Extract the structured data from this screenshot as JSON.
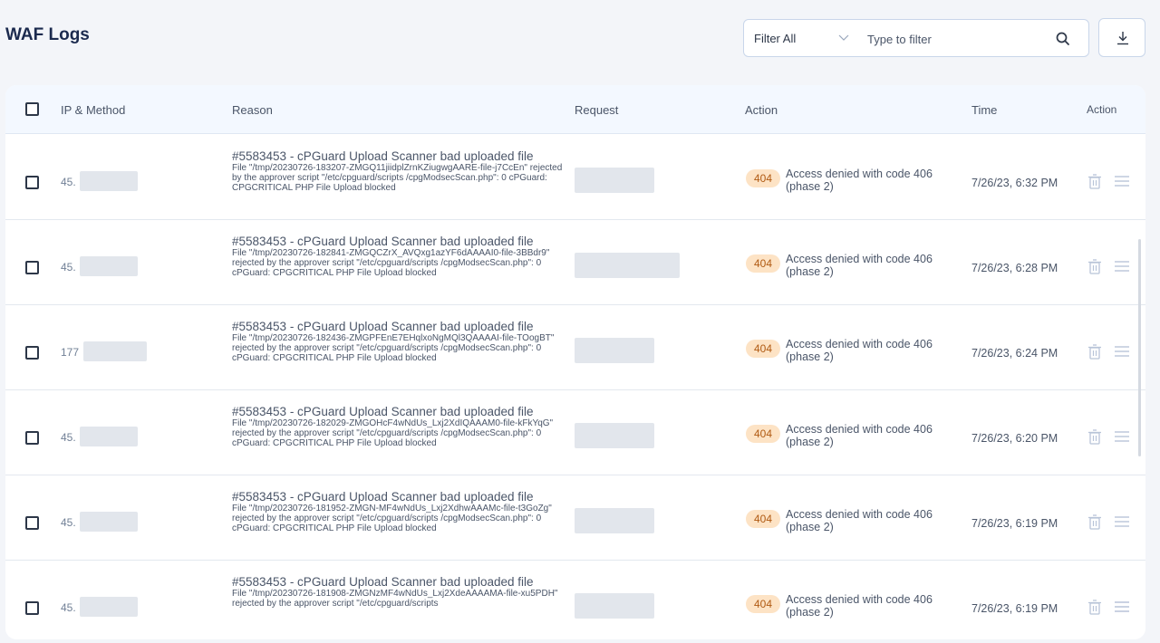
{
  "page": {
    "title": "WAF Logs"
  },
  "filter": {
    "select_label": "Filter All",
    "placeholder": "Type to filter"
  },
  "table": {
    "headers": {
      "ip": "IP & Method",
      "reason": "Reason",
      "request": "Request",
      "action": "Action",
      "time": "Time",
      "row_actions": "Action"
    },
    "rows": [
      {
        "ip": "45.",
        "reason_title": "#5583453 - cPGuard Upload Scanner bad uploaded file",
        "reason_detail": "File \"/tmp/20230726-183207-ZMGQ11jiidplZrnKZiugwgAARE-file-j7CcEn\" rejected by the approver script \"/etc/cpguard/scripts /cpgModsecScan.php\": 0 cPGuard: CPGCRITICAL PHP File Upload blocked",
        "code": "404",
        "action": "Access denied with code 406 (phase 2)",
        "time": "7/26/23, 6:32 PM"
      },
      {
        "ip": "45.",
        "reason_title": "#5583453 - cPGuard Upload Scanner bad uploaded file",
        "reason_detail": "File \"/tmp/20230726-182841-ZMGQCZrX_AVQxg1azYF6dAAAAI0-file-3BBdr9\" rejected by the approver script \"/etc/cpguard/scripts /cpgModsecScan.php\": 0 cPGuard: CPGCRITICAL PHP File Upload blocked",
        "code": "404",
        "action": "Access denied with code 406 (phase 2)",
        "time": "7/26/23, 6:28 PM"
      },
      {
        "ip": "177",
        "reason_title": "#5583453 - cPGuard Upload Scanner bad uploaded file",
        "reason_detail": "File \"/tmp/20230726-182436-ZMGPFEnE7EHqlxoNgMQl3QAAAAI-file-TOogBT\" rejected by the approver script \"/etc/cpguard/scripts /cpgModsecScan.php\": 0 cPGuard: CPGCRITICAL PHP File Upload blocked",
        "code": "404",
        "action": "Access denied with code 406 (phase 2)",
        "time": "7/26/23, 6:24 PM"
      },
      {
        "ip": "45.",
        "reason_title": "#5583453 - cPGuard Upload Scanner bad uploaded file",
        "reason_detail": "File \"/tmp/20230726-182029-ZMGOHcF4wNdUs_Lxj2XdIQAAAM0-file-kFkYqG\" rejected by the approver script \"/etc/cpguard/scripts /cpgModsecScan.php\": 0 cPGuard: CPGCRITICAL PHP File Upload blocked",
        "code": "404",
        "action": "Access denied with code 406 (phase 2)",
        "time": "7/26/23, 6:20 PM"
      },
      {
        "ip": "45.",
        "reason_title": "#5583453 - cPGuard Upload Scanner bad uploaded file",
        "reason_detail": "File \"/tmp/20230726-181952-ZMGN-MF4wNdUs_Lxj2XdhwAAAMc-file-t3GoZg\" rejected by the approver script \"/etc/cpguard/scripts /cpgModsecScan.php\": 0 cPGuard: CPGCRITICAL PHP File Upload blocked",
        "code": "404",
        "action": "Access denied with code 406 (phase 2)",
        "time": "7/26/23, 6:19 PM"
      },
      {
        "ip": "45.",
        "reason_title": "#5583453 - cPGuard Upload Scanner bad uploaded file",
        "reason_detail": "File \"/tmp/20230726-181908-ZMGNzMF4wNdUs_Lxj2XdeAAAAMA-file-xu5PDH\" rejected by the approver script \"/etc/cpguard/scripts",
        "code": "404",
        "action": "Access denied with code 406 (phase 2)",
        "time": "7/26/23, 6:19 PM"
      }
    ]
  },
  "icons": {
    "search": "search-icon",
    "download": "download-icon",
    "chevron": "chevron-down-icon",
    "trash": "trash-icon",
    "menu": "menu-icon"
  },
  "colors": {
    "title": "#1b2a4e",
    "badge_bg": "#fde3c5",
    "badge_text": "#b05a12",
    "icon_muted": "#b8c4d8"
  }
}
